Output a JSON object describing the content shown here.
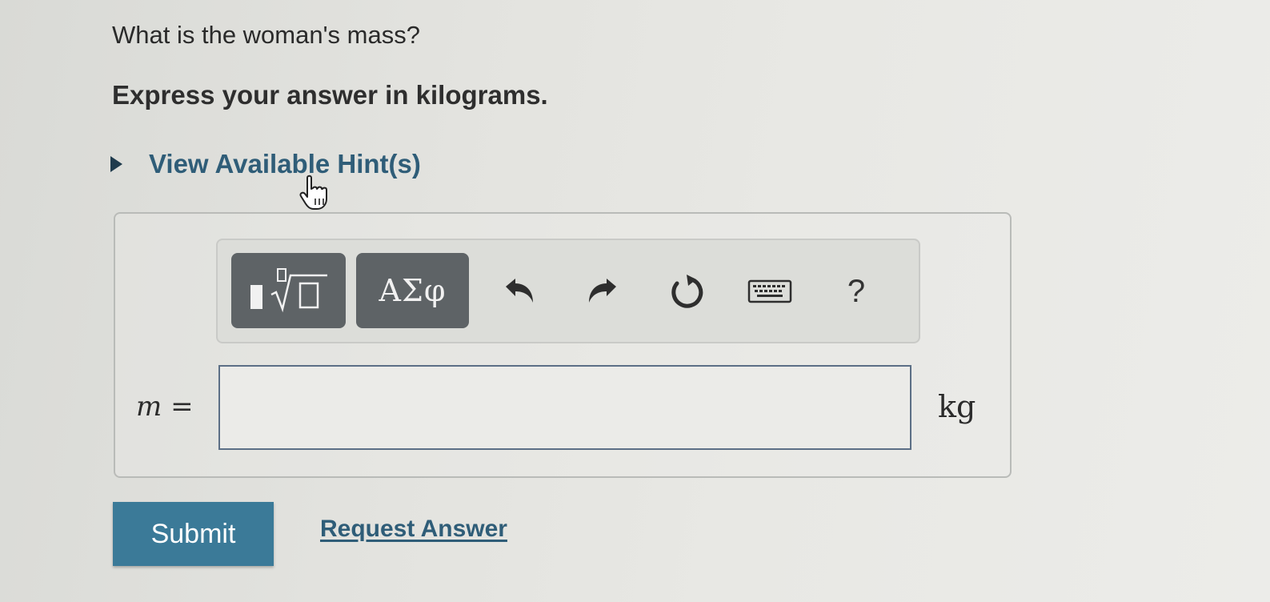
{
  "question": {
    "text": "What is the woman's mass?",
    "instruction": "Express your answer in kilograms."
  },
  "hint": {
    "label": "View Available Hint(s)",
    "icon": "play-triangle-icon"
  },
  "toolbar": {
    "templates_icon": "fraction-root-templates-icon",
    "greek_label": "ΑΣφ",
    "undo_icon": "undo-icon",
    "redo_icon": "redo-icon",
    "reset_icon": "reset-icon",
    "keyboard_icon": "keyboard-icon",
    "help_label": "?"
  },
  "answer": {
    "variable": "m",
    "equals": "=",
    "value": "",
    "unit": "kg"
  },
  "actions": {
    "submit_label": "Submit",
    "request_answer_label": "Request Answer"
  },
  "colors": {
    "link": "#2f5d78",
    "submit_bg": "#3b7a98",
    "tool_button_bg": "#5e6366",
    "input_border": "#5c6f86"
  }
}
